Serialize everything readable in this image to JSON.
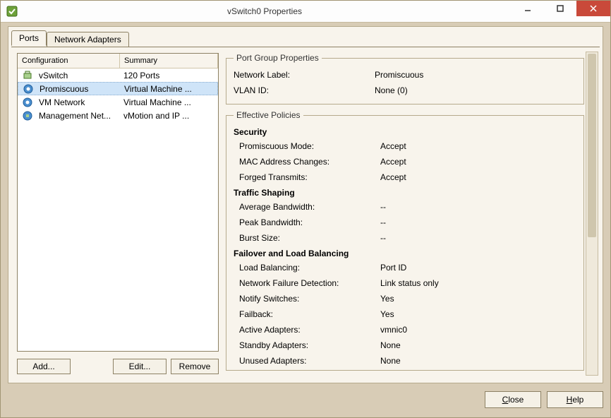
{
  "window": {
    "title": "vSwitch0 Properties"
  },
  "tabs": {
    "ports": "Ports",
    "adapters": "Network Adapters"
  },
  "list": {
    "headers": {
      "config": "Configuration",
      "summary": "Summary"
    },
    "rows": [
      {
        "config": "vSwitch",
        "summary": "120 Ports",
        "icon": "vswitch"
      },
      {
        "config": "Promiscuous",
        "summary": "Virtual Machine ...",
        "icon": "portgroup",
        "selected": true
      },
      {
        "config": "VM Network",
        "summary": "Virtual Machine ...",
        "icon": "portgroup"
      },
      {
        "config": "Management Net...",
        "summary": "vMotion and IP ...",
        "icon": "vmkernel"
      }
    ]
  },
  "buttons": {
    "add": "Add...",
    "edit": "Edit...",
    "remove": "Remove",
    "close": "Close",
    "help": "Help"
  },
  "portGroup": {
    "legend": "Port Group Properties",
    "networkLabel_l": "Network Label:",
    "networkLabel_v": "Promiscuous",
    "vlan_l": "VLAN ID:",
    "vlan_v": "None (0)"
  },
  "policies": {
    "legend": "Effective Policies",
    "security": {
      "head": "Security",
      "promisc_l": "Promiscuous Mode:",
      "promisc_v": "Accept",
      "mac_l": "MAC Address Changes:",
      "mac_v": "Accept",
      "forged_l": "Forged Transmits:",
      "forged_v": "Accept"
    },
    "shaping": {
      "head": "Traffic Shaping",
      "avg_l": "Average Bandwidth:",
      "avg_v": "--",
      "peak_l": "Peak Bandwidth:",
      "peak_v": "--",
      "burst_l": "Burst Size:",
      "burst_v": "--"
    },
    "failover": {
      "head": "Failover and Load Balancing",
      "lb_l": "Load Balancing:",
      "lb_v": "Port ID",
      "detect_l": "Network Failure Detection:",
      "detect_v": "Link status only",
      "notify_l": "Notify Switches:",
      "notify_v": "Yes",
      "failback_l": "Failback:",
      "failback_v": "Yes",
      "active_l": "Active Adapters:",
      "active_v": "vmnic0",
      "standby_l": "Standby Adapters:",
      "standby_v": "None",
      "unused_l": "Unused Adapters:",
      "unused_v": "None"
    }
  }
}
